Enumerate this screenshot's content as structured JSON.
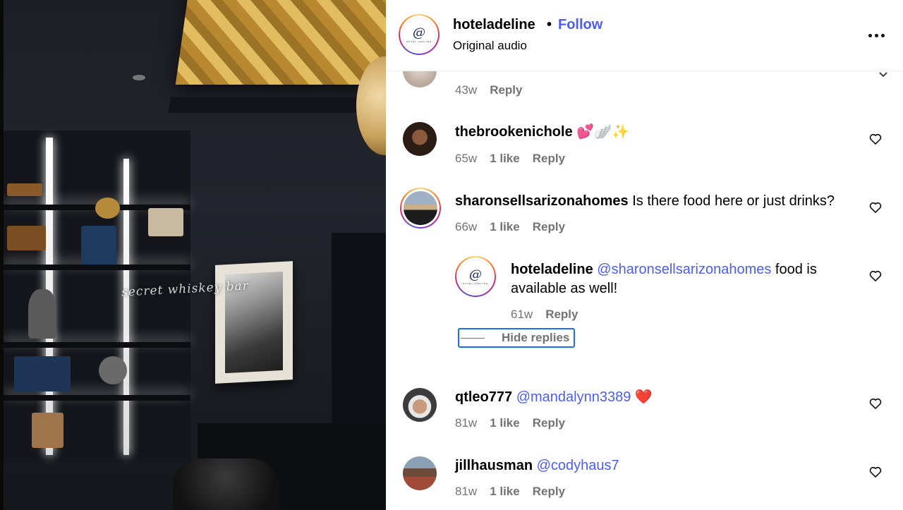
{
  "media": {
    "overlay_text": "secret whiskey bar"
  },
  "header": {
    "username": "hoteladeline",
    "separator": "•",
    "follow_label": "Follow",
    "audio_label": "Original audio",
    "logo_mark": "@",
    "logo_subtext": "HOTEL ADELINE"
  },
  "comments": [
    {
      "username": "",
      "text": "",
      "age": "43w",
      "likes": "",
      "reply_label": "Reply"
    },
    {
      "username": "thebrookenichole",
      "text": "💕🪽✨",
      "age": "65w",
      "likes": "1 like",
      "reply_label": "Reply"
    },
    {
      "username": "sharonsellsarizonahomes",
      "text": "Is there food here or just drinks?",
      "age": "66w",
      "likes": "1 like",
      "reply_label": "Reply",
      "reply": {
        "username": "hoteladeline",
        "mention": "@sharonsellsarizonahomes",
        "text_line1": "food is",
        "text_line2": "available as well!",
        "age": "61w",
        "reply_label": "Reply"
      },
      "hide_replies_label": "Hide replies"
    },
    {
      "username": "qtleo777",
      "mention": "@mandalynn3389",
      "text": "❤️",
      "age": "81w",
      "likes": "1 like",
      "reply_label": "Reply"
    },
    {
      "username": "jillhausman",
      "mention": "@codyhaus7",
      "text": "",
      "age": "81w",
      "likes": "1 like",
      "reply_label": "Reply"
    }
  ],
  "colors": {
    "link_blue": "#4a5df9",
    "meta_gray": "#737373",
    "focus_outline": "#1a6ee8"
  }
}
